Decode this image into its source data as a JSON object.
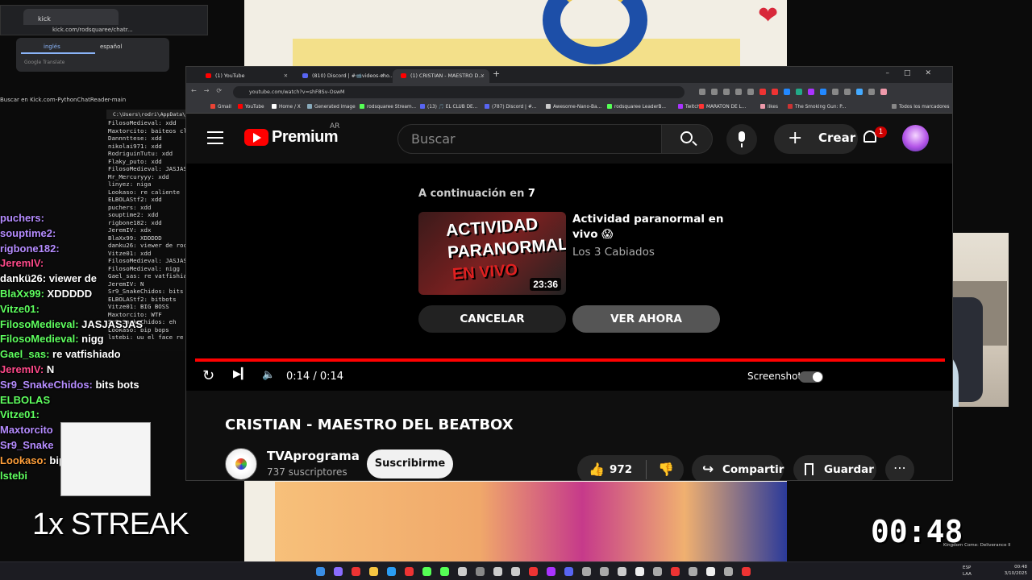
{
  "kick_window": {
    "tab_title": "kick",
    "url": "kick.com/rodsquaree/chatr..."
  },
  "translate_popup": {
    "lang_en": "inglés",
    "lang_es": "español",
    "footer": "Google Translate"
  },
  "busy_text": "Buscar en Kick.com-PythonChatReader-main",
  "terminal": {
    "title": "C:\\Users\\rodri\\AppData\\Loc",
    "lines": [
      "FilosoMedieval: xdd",
      "Maxtorcito: baiteos cl",
      "Dannnttese: xdd",
      "nikolai971: xdd",
      "RodriguinTutu: xdd",
      "Flaky_puto: xdd",
      "FilosoMedieval: JASJAS",
      "Mr_Mercuryyy: xdd",
      "linyez: niga",
      "Lookaso: re caliente",
      "ELBOLAStf2: xdd",
      "puchers: xdd",
      "souptime2: xdd",
      "rigbone182: xdd",
      "JeremIV: xdx",
      "BlaXx99: XDDDDD",
      "danku26: viewer de roc",
      "Vitze01: xdd",
      "FilosoMedieval: JASJAS",
      "FilosoMedieval: nigg",
      "Gael_sas: re vatfishia",
      "JeremIV: N",
      "Sr9_SnakeChidos: bits",
      "ELBOLAStf2: bitbots",
      "Vitze01: BIG BOSS",
      "Maxtorcito: WTF",
      "Sr9_SnakeChidos: eh",
      "Lookaso: bip bops",
      "lstebi: uu el face re"
    ]
  },
  "overlay_chat": [
    {
      "user": "puchers:",
      "msg": "",
      "color": "#b58cff"
    },
    {
      "user": "souptime2:",
      "msg": "",
      "color": "#b58cff"
    },
    {
      "user": "rigbone182:",
      "msg": "",
      "color": "#b58cff"
    },
    {
      "user": "JeremIV:",
      "msg": "",
      "color": "#ff4a8a"
    },
    {
      "user": "dankü26:",
      "msg": "viewer de",
      "color": "#ffffff"
    },
    {
      "user": "BlaXx99:",
      "msg": "XDDDDD",
      "color": "#5fff5f"
    },
    {
      "user": "Vitze01:",
      "msg": "",
      "color": "#5fff5f"
    },
    {
      "user": "FilosoMedieval:",
      "msg": "JASJASJAS",
      "color": "#5fff5f"
    },
    {
      "user": "FilosoMedieval:",
      "msg": "nigg",
      "color": "#5fff5f"
    },
    {
      "user": "Gael_sas:",
      "msg": "re vatfishiado",
      "color": "#5fff5f"
    },
    {
      "user": "JeremIV:",
      "msg": "N",
      "color": "#ff4a8a"
    },
    {
      "user": "Sr9_SnakeChidos:",
      "msg": "bits bots",
      "color": "#b58cff"
    },
    {
      "user": "ELBOLAS",
      "msg": "",
      "color": "#5fff5f"
    },
    {
      "user": "Vitze01:",
      "msg": "",
      "color": "#5fff5f"
    },
    {
      "user": "Maxtorcito",
      "msg": "",
      "color": "#b58cff"
    },
    {
      "user": "Sr9_Snake",
      "msg": "",
      "color": "#b58cff"
    },
    {
      "user": "Lookaso:",
      "msg": "bip",
      "color": "#ff9f3a"
    },
    {
      "user": "lstebi",
      "msg": "",
      "color": "#5fff5f"
    }
  ],
  "streak": "1x STREAK",
  "timer": "00:48",
  "game_note": "Kingdom Come: Deliverance II",
  "browser": {
    "tabs": [
      {
        "title": "(1) YouTube",
        "active": false
      },
      {
        "title": "(810) Discord | #📹videos-cho...",
        "active": false
      },
      {
        "title": "(1) CRISTIAN - MAESTRO D...",
        "active": true
      }
    ],
    "url": "youtube.com/watch?v=shF8Sv-OswM",
    "bookmarks": [
      "Gmail",
      "YouTube",
      "Home / X",
      "Generated image",
      "rodsquaree Stream...",
      "(13) 🎵 EL CLUB DE...",
      "(787) Discord | #...",
      "Awesome-Nano-Ba...",
      "rodsquaree LeaderB...",
      "Twitch",
      "MARATON DE L...",
      "likes",
      "The Smoking Gun: P...",
      "Todos los marcadores"
    ]
  },
  "youtube": {
    "logo_text": "Premium",
    "country": "AR",
    "search_placeholder": "Buscar",
    "create_label": "Crear",
    "notif_count": "1",
    "up_next_prefix": "A continuación en",
    "up_next_count": "7",
    "next_title": "Actividad paranormal en vivo 😱",
    "next_channel": "Los 3 Cabiados",
    "thumb_line1": "ACTIVIDAD",
    "thumb_line2": "PARANORMAL",
    "thumb_line3": "EN VIVO",
    "thumb_duration": "23:36",
    "cancel_label": "CANCELAR",
    "watch_now_label": "VER AHORA",
    "time_display": "0:14 / 0:14",
    "screenshot_label": "Screenshot",
    "video_title": "CRISTIAN - MAESTRO DEL BEATBOX",
    "channel_name": "TVAprograma",
    "subscribers": "737 suscriptores",
    "subscribe_label": "Suscribirme",
    "likes": "972",
    "share_label": "Compartir",
    "save_label": "Guardar",
    "progress": 1.0
  },
  "taskbar": {
    "lang_top": "ESP",
    "lang_bottom": "LAA",
    "time": "00:48",
    "date": "3/10/2025"
  }
}
